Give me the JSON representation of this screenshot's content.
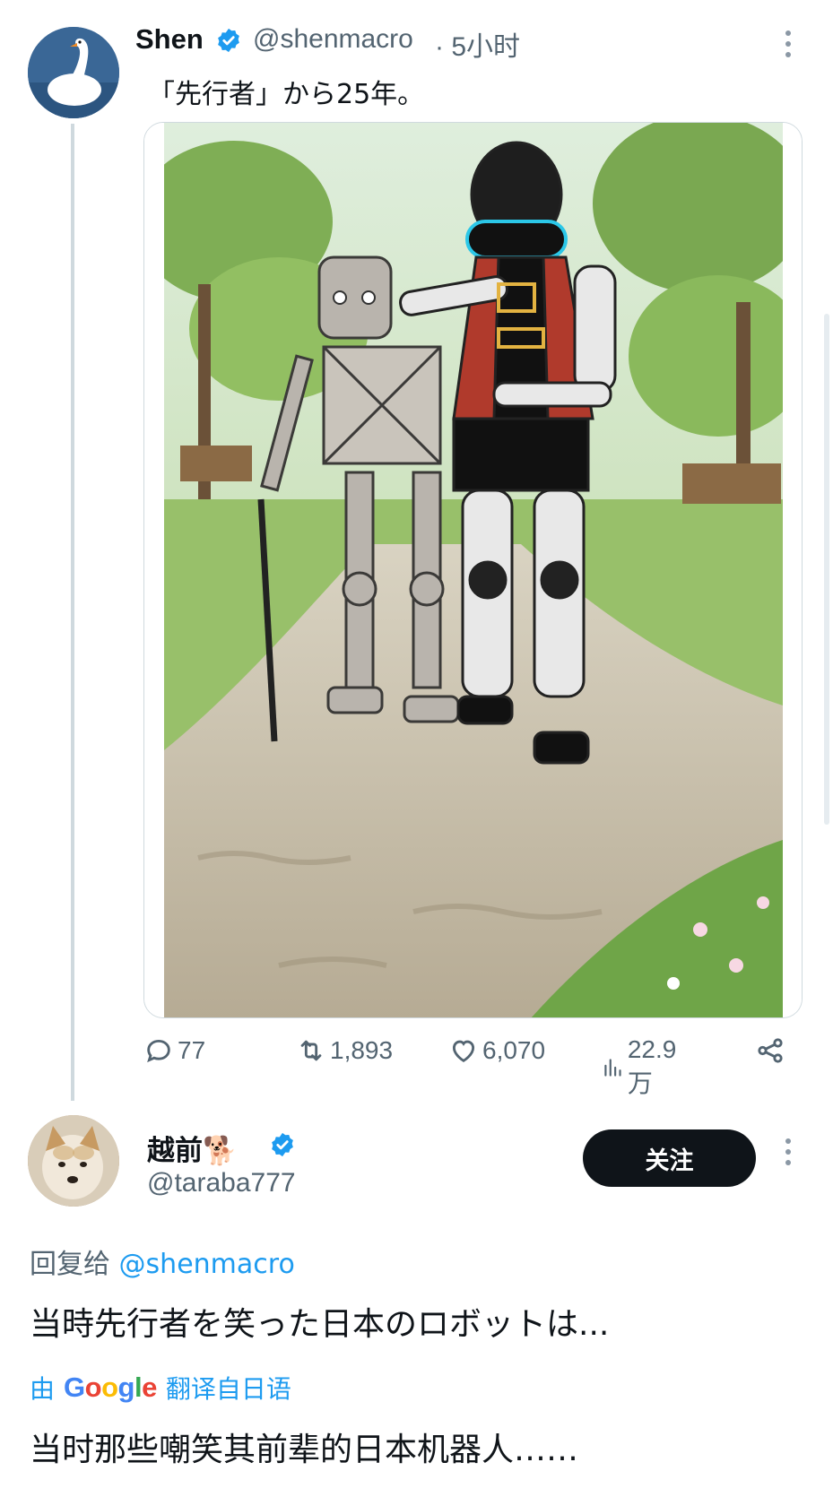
{
  "tweet": {
    "author_name": "Shen",
    "handle": "@shenmacro",
    "time": "· 5小时",
    "text": "「先行者」から25年。",
    "avatar_icon": "swan-avatar",
    "media_description_icon": "robot-illustration",
    "stats": {
      "replies": "77",
      "retweets": "1,893",
      "likes": "6,070",
      "views": "22.9万"
    }
  },
  "reply": {
    "author_name": "越前🐕",
    "handle": "@taraba777",
    "follow_label": "关注",
    "reply_to_prefix": "回复给 ",
    "reply_to_mention": "@shenmacro",
    "text": "当時先行者を笑った日本のロボットは...",
    "translated_by_prefix": "由",
    "translated_from": "翻译自日语",
    "translated_text": "当时那些嘲笑其前辈的日本机器人……",
    "avatar_icon": "shiba-dog-avatar"
  },
  "colors": {
    "accent": "#1d9bf0",
    "text": "#0f1419",
    "muted": "#536471",
    "button_bg": "#0f1419"
  }
}
